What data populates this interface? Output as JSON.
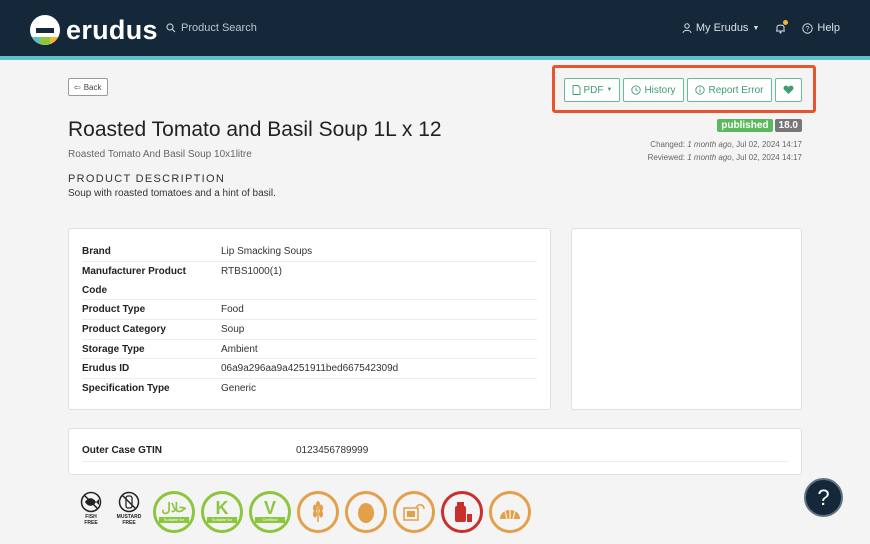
{
  "header": {
    "logo_text": "erudus",
    "search_label": "Product Search",
    "my_account_label": "My Erudus",
    "help_label": "Help",
    "colors": {
      "bar": "#14283a",
      "accent": "#5bc0c8"
    }
  },
  "toolbar": {
    "back_label": "Back",
    "pdf_label": "PDF",
    "history_label": "History",
    "report_label": "Report Error",
    "favorite_icon": "heart-icon",
    "accent": "#3f9c72",
    "highlight": "#e8542e"
  },
  "product": {
    "title": "Roasted Tomato and Basil Soup 1L x 12",
    "subtitle": "Roasted Tomato And Basil Soup 10x1litre",
    "description_heading": "PRODUCT DESCRIPTION",
    "description": "Soup with roasted tomatoes and a hint of basil."
  },
  "status": {
    "state": "published",
    "version": "18.0",
    "changed_label": "Changed:",
    "changed_relative": "1 month ago",
    "changed_date": ", Jul 02, 2024 14:17",
    "reviewed_label": "Reviewed:",
    "reviewed_relative": "1 month ago",
    "reviewed_date": ", Jul 02, 2024 14:17"
  },
  "specs": {
    "rows": [
      {
        "label": "Brand",
        "value": "Lip Smacking Soups"
      },
      {
        "label": "Manufacturer Product",
        "label2": "Code",
        "value": "RTBS1000(1)"
      },
      {
        "label": "Product Type",
        "value": "Food"
      },
      {
        "label": "Product Category",
        "value": "Soup"
      },
      {
        "label": "Storage Type",
        "value": "Ambient"
      },
      {
        "label": "Erudus ID",
        "value": "06a9a296aa9a4251911bed667542309d"
      },
      {
        "label": "Specification Type",
        "value": "Generic"
      }
    ]
  },
  "gtin": {
    "label": "Outer Case GTIN",
    "value": "0123456789999"
  },
  "dietary_icons": [
    {
      "icon": "fish-free-icon",
      "label": "FISH",
      "label2": "FREE"
    },
    {
      "icon": "mustard-free-icon",
      "label": "MUSTARD",
      "label2": "FREE"
    },
    {
      "icon": "halal-icon",
      "ribbon": "Suitable for"
    },
    {
      "icon": "kosher-icon",
      "ribbon": "Suitable for"
    },
    {
      "icon": "vegetarian-icon",
      "ribbon": "Certified"
    },
    {
      "icon": "gluten-icon"
    },
    {
      "icon": "egg-icon"
    },
    {
      "icon": "soya-icon"
    },
    {
      "icon": "milk-icon"
    },
    {
      "icon": "shellfish-icon"
    }
  ],
  "help_bubble": "?"
}
